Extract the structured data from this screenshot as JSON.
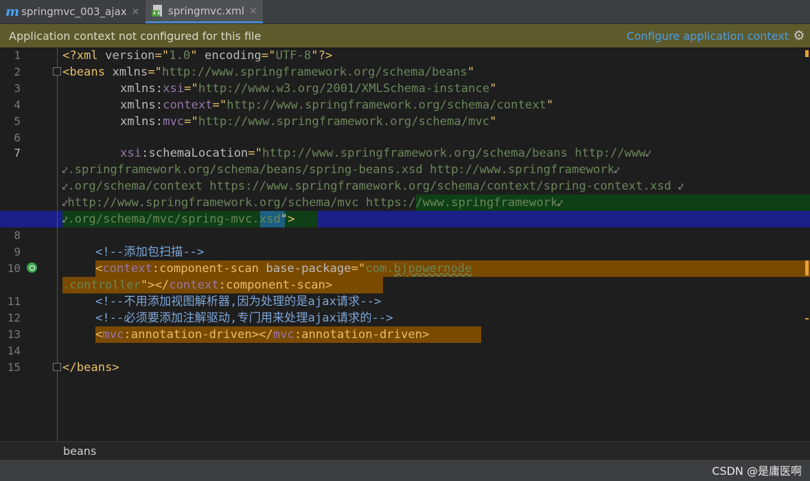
{
  "tabs": [
    {
      "label": "springmvc_003_ajax",
      "icon": "maven-module-icon",
      "icon_glyph": "m"
    },
    {
      "label": "springmvc.xml",
      "icon": "xml-file-icon"
    }
  ],
  "tab_close_glyph": "×",
  "banner": {
    "message": "Application context not configured for this file",
    "link": "Configure application context",
    "gear_glyph": "⚙"
  },
  "line_numbers": [
    "1",
    "2",
    "3",
    "4",
    "5",
    "6",
    "7",
    "8",
    "9",
    "10",
    "11",
    "12",
    "13",
    "14",
    "15"
  ],
  "code": {
    "l1": {
      "a": "<?xml ",
      "b": "version",
      "c": "=\"",
      "d": "1.0",
      "e": "\" ",
      "f": "encoding",
      "g": "=\"",
      "h": "UTF-8",
      "i": "\"?>"
    },
    "l2": {
      "tag": "<beans ",
      "attr": "xmlns",
      "eq": "=\"",
      "val": "http://www.springframework.org/schema/beans",
      "q": "\""
    },
    "l3": {
      "attr": "xmlns:",
      "ns": "xsi",
      "eq": "=\"",
      "val": "http://www.w3.org/2001/XMLSchema-instance",
      "q": "\""
    },
    "l4": {
      "attr": "xmlns:",
      "ns": "context",
      "eq": "=\"",
      "val": "http://www.springframework.org/schema/context",
      "q": "\""
    },
    "l5": {
      "attr": "xmlns:",
      "ns": "mvc",
      "eq": "=\"",
      "val": "http://www.springframework.org/schema/mvc",
      "q": "\""
    },
    "l7a": {
      "ns": "xsi",
      "attr": ":schemaLocation",
      "eq": "=\"",
      "val": "http://www.springframework.org/schema/beans http://www"
    },
    "l7b": ".springframework.org/schema/beans/spring-beans.xsd http://www.springframework",
    "l7c": ".org/schema/context https://www.springframework.org/schema/context/spring-context.xsd ",
    "l7d": "http://www.springframework.org/schema/mvc https://www.springframework",
    "l7e": {
      "a": ".org/schema/mvc/spring-",
      "b": "mvc",
      ".c": "",
      "c": ".xsd",
      "d": "\">"
    },
    "l9": "<!--添加包扫描-->",
    "l10a": {
      "open": "<",
      "ns": "context",
      "name": ":component-scan ",
      "attr": "base-package",
      "eq": "=\"",
      "val1": "com.",
      "val2": "bjpowernode"
    },
    "l10b": {
      "val": ".controller",
      "q": "\"></",
      "ns": "context",
      "name": ":component-scan>"
    },
    "l11": "<!--不用添加视图解析器,因为处理的是ajax请求-->",
    "l12": "<!--必须要添加注解驱动,专门用来处理ajax请求的-->",
    "l13": {
      "open": "<",
      "ns1": "mvc",
      "n1": ":annotation-driven></",
      "ns2": "mvc",
      "n2": ":annotation-driven>"
    },
    "l15": "</beans>"
  },
  "wrap_glyph": "⤦",
  "breadcrumb": "beans",
  "watermark": "CSDN @是庸医啊",
  "colors": {
    "tag": "#e8bf6a",
    "value": "#6a8759",
    "namespace": "#9876aa",
    "comment": "#7ea6d8",
    "banner": "#5e5a2c",
    "link": "#4a9de6"
  }
}
